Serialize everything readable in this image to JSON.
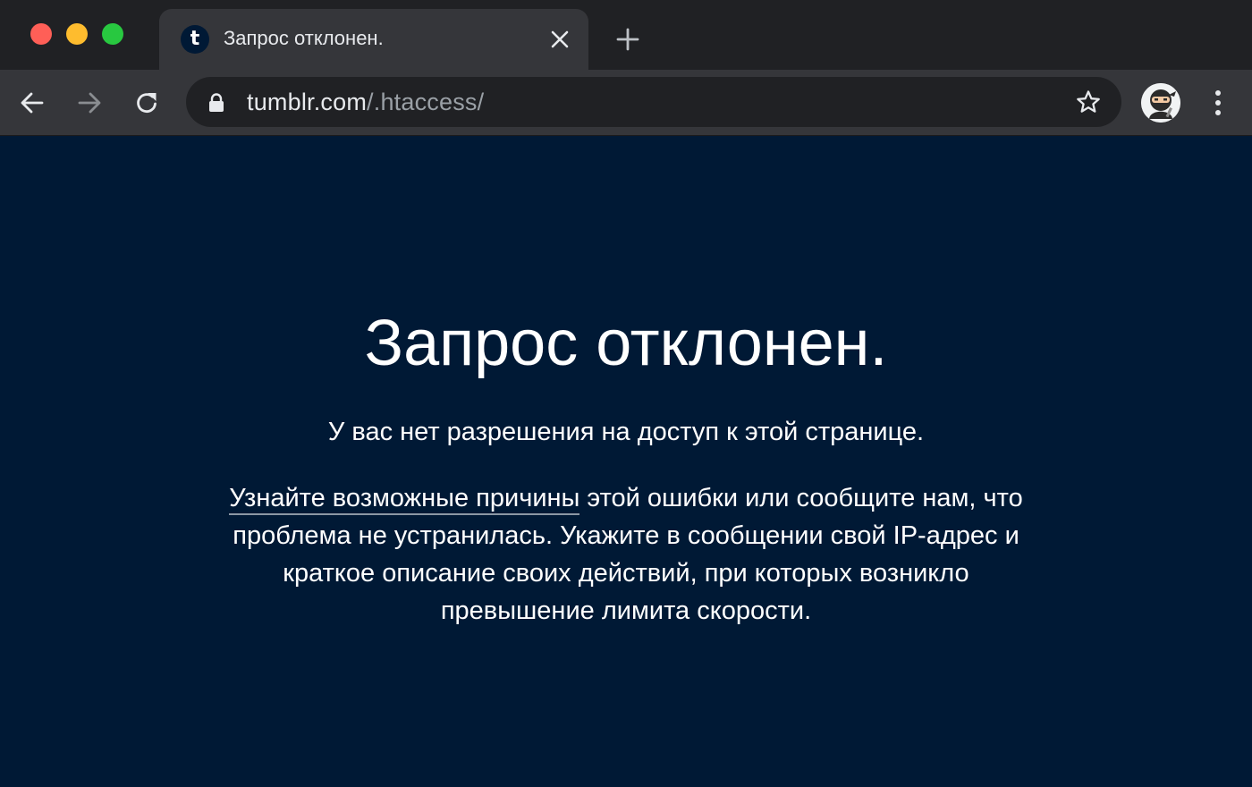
{
  "browser": {
    "tab": {
      "favicon_letter": "t",
      "title": "Запрос отклонен."
    },
    "address": {
      "host": "tumblr.com",
      "path": "/.htaccess/"
    },
    "icons": {
      "back": "arrow-left-icon",
      "forward": "arrow-right-icon",
      "reload": "reload-icon",
      "lock": "lock-icon",
      "star": "star-outline-icon",
      "close_tab": "close-icon",
      "new_tab": "plus-icon",
      "menu": "vertical-dots-icon",
      "profile": "ninja-avatar-icon"
    }
  },
  "page": {
    "heading": "Запрос отклонен.",
    "subtitle": "У вас нет разрешения на доступ к этой странице.",
    "reasons_link": "Узнайте возможные причины",
    "body_rest": " этой ошибки или сообщите нам, что проблема не устранилась. Укажите в сообщении свой IP-адрес и краткое описание своих действий, при которых возникло превышение лимита скорости."
  },
  "colors": {
    "page_background": "#001935",
    "tab_strip": "#202124",
    "toolbar": "#35363a",
    "traffic_close": "#ff5f57",
    "traffic_minimize": "#febc2e",
    "traffic_maximize": "#28c840"
  }
}
